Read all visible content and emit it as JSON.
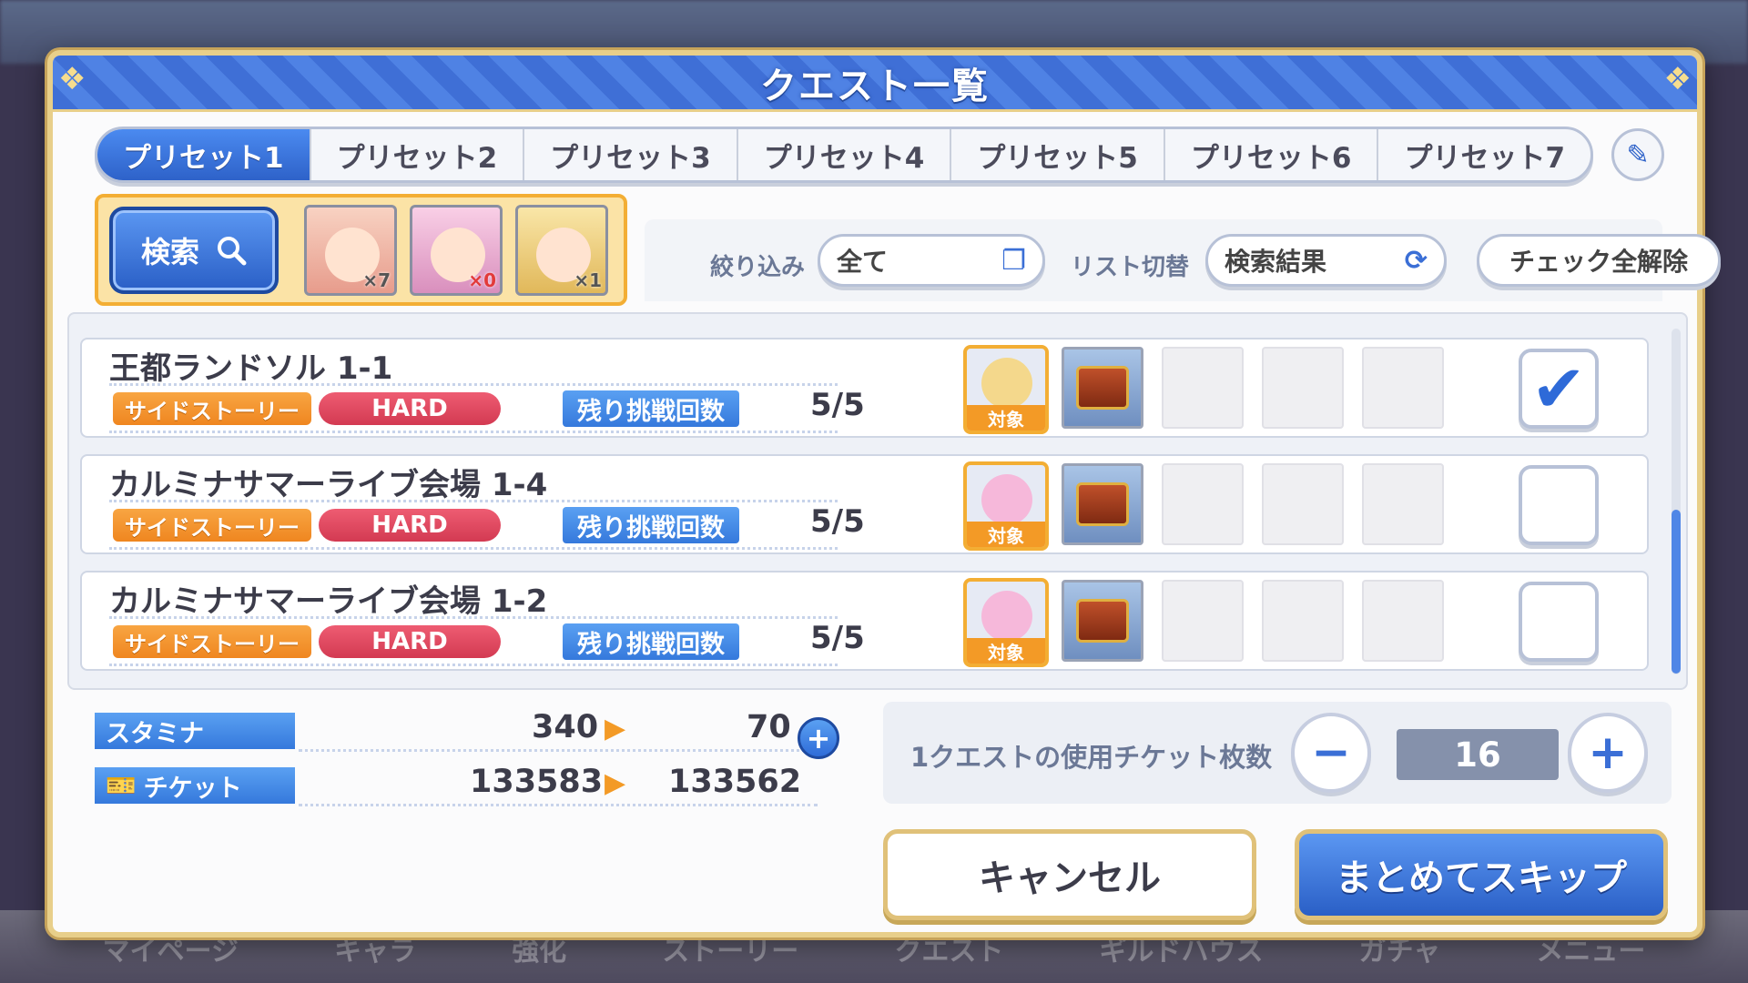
{
  "header": {
    "title": "クエスト一覧"
  },
  "tabs": [
    {
      "label": "プリセット1"
    },
    {
      "label": "プリセット2"
    },
    {
      "label": "プリセット3"
    },
    {
      "label": "プリセット4"
    },
    {
      "label": "プリセット5"
    },
    {
      "label": "プリセット6"
    },
    {
      "label": "プリセット7"
    }
  ],
  "search": {
    "label": "検索"
  },
  "characters": [
    {
      "badge": "×7",
      "color": "#f3b7a8"
    },
    {
      "badge": "×0",
      "color": "#f6b8da"
    },
    {
      "badge": "×1",
      "color": "#f4d88c"
    }
  ],
  "filter": {
    "narrow_label": "絞り込み",
    "narrow_value": "全て",
    "list_label": "リスト切替",
    "list_value": "検索結果",
    "uncheck_all": "チェック全解除"
  },
  "quests": [
    {
      "name": "王都ランドソル 1-1",
      "story_tag": "サイドストーリー",
      "difficulty": "HARD",
      "remain_label": "残り挑戦回数",
      "remain": "5/5",
      "target_label": "対象",
      "target_color": "#f4d88c",
      "checked": true
    },
    {
      "name": "カルミナサマーライブ会場 1-4",
      "story_tag": "サイドストーリー",
      "difficulty": "HARD",
      "remain_label": "残り挑戦回数",
      "remain": "5/5",
      "target_label": "対象",
      "target_color": "#f6b8da",
      "checked": false
    },
    {
      "name": "カルミナサマーライブ会場 1-2",
      "story_tag": "サイドストーリー",
      "difficulty": "HARD",
      "remain_label": "残り挑戦回数",
      "remain": "5/5",
      "target_label": "対象",
      "target_color": "#f6b8da",
      "checked": false
    }
  ],
  "stamina": {
    "label": "スタミナ",
    "before": "340",
    "after": "70"
  },
  "ticket": {
    "label": "チケット",
    "before": "133583",
    "after": "133562"
  },
  "ticket_per_quest": {
    "label": "1クエストの使用チケット枚数",
    "value": "16",
    "minus": "−",
    "plus": "+"
  },
  "buttons": {
    "cancel": "キャンセル",
    "skip": "まとめてスキップ"
  },
  "background_nav": [
    "マイページ",
    "キャラ",
    "強化",
    "ストーリー",
    "クエスト",
    "ギルドハウス",
    "ガチャ",
    "メニュー"
  ]
}
